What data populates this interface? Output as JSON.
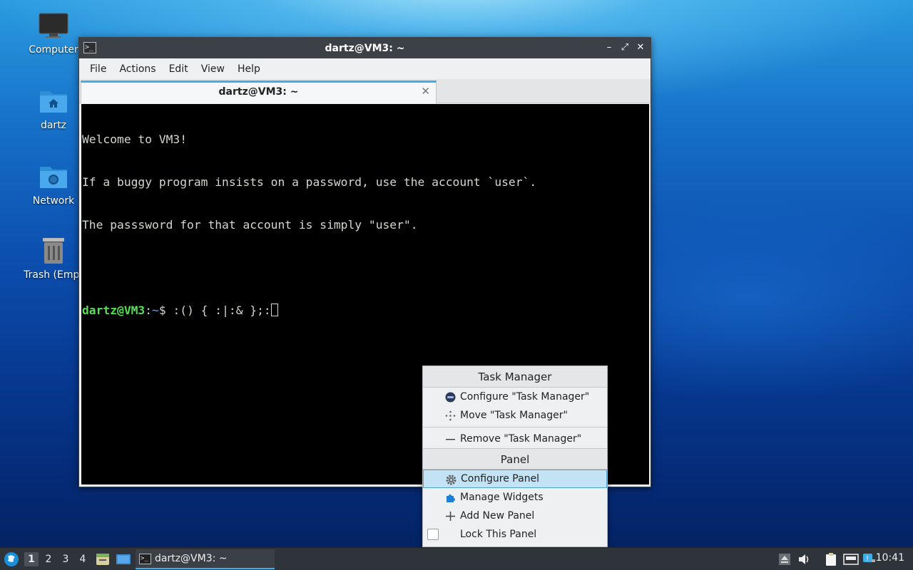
{
  "desktop": {
    "icons": [
      {
        "label": "Computer"
      },
      {
        "label": "dartz"
      },
      {
        "label": "Network"
      },
      {
        "label": "Trash (Empt"
      }
    ]
  },
  "window": {
    "title": "dartz@VM3: ~",
    "app_icon_glyph": ">_",
    "controls": {
      "minimize": "–",
      "maximize": "⤢",
      "close": "✕"
    },
    "menu": [
      "File",
      "Actions",
      "Edit",
      "View",
      "Help"
    ],
    "tab": {
      "label": "dartz@VM3: ~",
      "close": "✕"
    }
  },
  "terminal": {
    "lines": [
      "Welcome to VM3!",
      "If a buggy program insists on a password, use the account `user`.",
      "The passsword for that account is simply \"user\"."
    ],
    "prompt_user": "dartz@VM3",
    "prompt_sep": ":",
    "prompt_path": "~",
    "prompt_symbol": "$ ",
    "command": ":() { :|:& };:"
  },
  "context_menu": {
    "section1_title": "Task Manager",
    "configure_task_manager": "Configure \"Task Manager\"",
    "move_task_manager": "Move \"Task Manager\"",
    "remove_task_manager": "Remove \"Task Manager\"",
    "section2_title": "Panel",
    "configure_panel": "Configure Panel",
    "manage_widgets": "Manage Widgets",
    "add_new_panel": "Add New Panel",
    "lock_this_panel": "Lock This Panel",
    "lock_checked": false
  },
  "taskbar": {
    "workspaces": [
      "1",
      "2",
      "3",
      "4"
    ],
    "active_workspace": "1",
    "task_label": "dartz@VM3: ~",
    "clock": "10:41"
  },
  "colors": {
    "accent": "#3daee9",
    "prompt_user": "#55e055",
    "prompt_path": "#5fa8ff",
    "menu_highlight": "#c3e2f4"
  }
}
